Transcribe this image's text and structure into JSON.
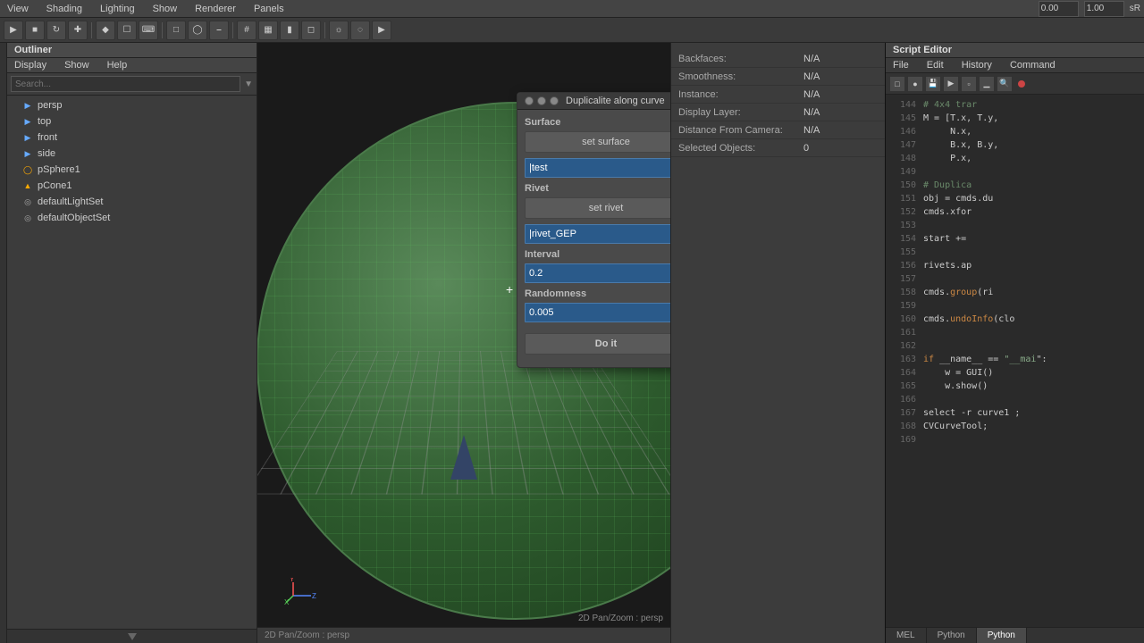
{
  "outliner": {
    "title": "Outliner",
    "menu": [
      "Display",
      "Show",
      "Help"
    ],
    "search_placeholder": "Search...",
    "items": [
      {
        "label": "persp",
        "type": "cam",
        "indent": 1
      },
      {
        "label": "top",
        "type": "cam",
        "indent": 1
      },
      {
        "label": "front",
        "type": "cam",
        "indent": 1
      },
      {
        "label": "side",
        "type": "cam",
        "indent": 1
      },
      {
        "label": "pSphere1",
        "type": "mesh",
        "indent": 1
      },
      {
        "label": "pCone1",
        "type": "mesh",
        "indent": 1
      },
      {
        "label": "defaultLightSet",
        "type": "set",
        "indent": 1
      },
      {
        "label": "defaultObjectSet",
        "type": "set",
        "indent": 1
      }
    ]
  },
  "dialog": {
    "title": "Duplicalite along curve",
    "surface_label": "Surface",
    "set_surface_btn": "set surface",
    "surface_input_value": "|test",
    "rivet_label": "Rivet",
    "set_rivet_btn": "set rivet",
    "rivet_input_value": "|rivet_GEP",
    "interval_label": "Interval",
    "interval_value": "0.2",
    "randomness_label": "Randomness",
    "randomness_value": "0.005",
    "doit_btn": "Do it"
  },
  "viewport": {
    "bottom_label": "2D Pan/Zoom : persp"
  },
  "properties": {
    "rows": [
      {
        "label": "Backfaces:",
        "value": "N/A"
      },
      {
        "label": "Smoothness:",
        "value": "N/A"
      },
      {
        "label": "Instance:",
        "value": "N/A"
      },
      {
        "label": "Display Layer:",
        "value": "N/A"
      },
      {
        "label": "Distance From Camera:",
        "value": "N/A"
      },
      {
        "label": "Selected Objects:",
        "value": "0"
      }
    ]
  },
  "toolbar": {
    "value1": "0.00",
    "value2": "1.00",
    "value3": "sR"
  },
  "script_editor": {
    "title": "Script Editor",
    "menu_items": [
      "File",
      "Edit",
      "History",
      "Command"
    ],
    "tabs": [
      "MEL",
      "Python",
      "Python"
    ],
    "lines": [
      {
        "num": "144",
        "code": "# 4x4 trar",
        "type": "comment"
      },
      {
        "num": "145",
        "code": "M = [T.x, T.y,",
        "type": "normal"
      },
      {
        "num": "146",
        "code": "     N.x,",
        "type": "normal"
      },
      {
        "num": "147",
        "code": "     B.x, B.y,",
        "type": "normal"
      },
      {
        "num": "148",
        "code": "     P.x,",
        "type": "normal"
      },
      {
        "num": "149",
        "code": "",
        "type": "normal"
      },
      {
        "num": "150",
        "code": "# Duplica",
        "type": "comment"
      },
      {
        "num": "151",
        "code": "obj = cmds.du",
        "type": "normal"
      },
      {
        "num": "152",
        "code": "cmds.xfor",
        "type": "normal"
      },
      {
        "num": "153",
        "code": "",
        "type": "normal"
      },
      {
        "num": "154",
        "code": "start +=",
        "type": "normal"
      },
      {
        "num": "155",
        "code": "",
        "type": "normal"
      },
      {
        "num": "156",
        "code": "rivets.ap",
        "type": "normal"
      },
      {
        "num": "157",
        "code": "",
        "type": "normal"
      },
      {
        "num": "158",
        "code": "cmds.group(ri",
        "type": "normal"
      },
      {
        "num": "159",
        "code": "",
        "type": "normal"
      },
      {
        "num": "160",
        "code": "cmds.undoInfo(clo",
        "type": "normal"
      },
      {
        "num": "161",
        "code": "",
        "type": "normal"
      },
      {
        "num": "162",
        "code": "",
        "type": "normal"
      },
      {
        "num": "163",
        "code": "if __name__ == \"__mai\":",
        "type": "keyword"
      },
      {
        "num": "164",
        "code": "    w = GUI()",
        "type": "normal"
      },
      {
        "num": "165",
        "code": "    w.show()",
        "type": "normal"
      },
      {
        "num": "166",
        "code": "",
        "type": "normal"
      },
      {
        "num": "167",
        "code": "select -r curve1 ;",
        "type": "normal"
      },
      {
        "num": "168",
        "code": "CVCurveTool;",
        "type": "normal"
      },
      {
        "num": "169",
        "code": "",
        "type": "normal"
      }
    ]
  }
}
